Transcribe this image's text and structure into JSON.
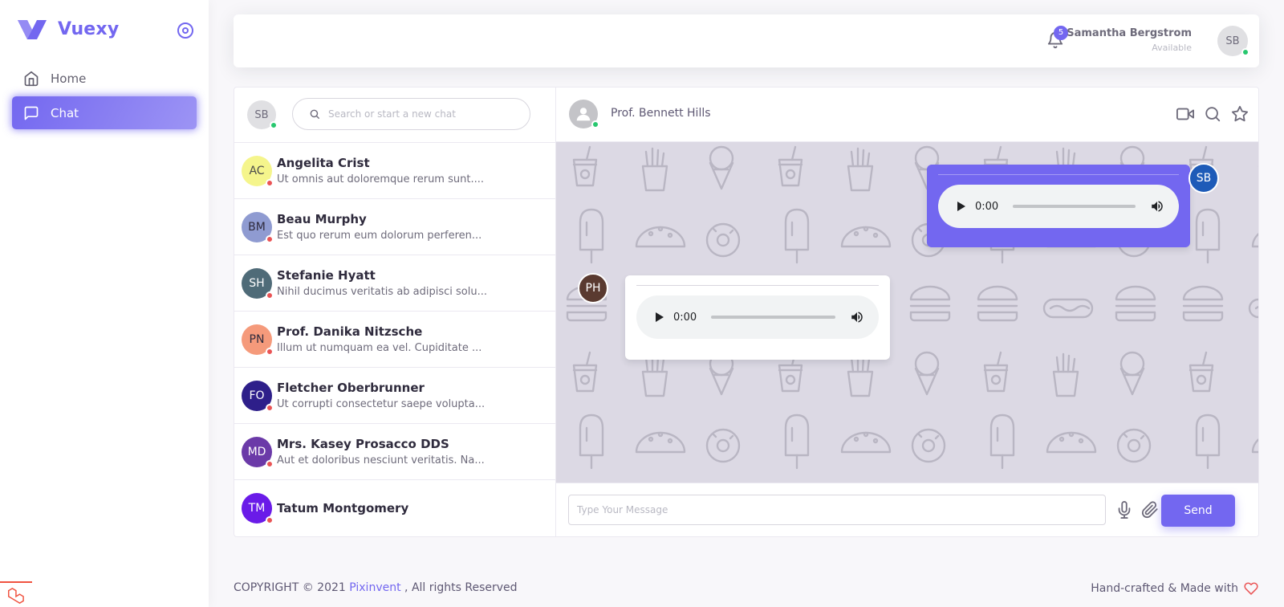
{
  "brand": {
    "name": "Vuexy"
  },
  "nav": {
    "items": [
      {
        "label": "Home",
        "icon": "home-icon"
      },
      {
        "label": "Chat",
        "icon": "message-square-icon",
        "active": true
      }
    ]
  },
  "header": {
    "notifications_count": "5",
    "user_name": "Samantha Bergstrom",
    "user_status": "Available",
    "user_initials": "SB"
  },
  "chat": {
    "my_initials": "SB",
    "search_placeholder": "Search or start a new chat",
    "contacts": [
      {
        "initials": "AC",
        "name": "Angelita Crist",
        "preview": "Ut omnis aut doloremque rerum sunt....",
        "color": "#f5f58c",
        "text_color": "#4b4b4b"
      },
      {
        "initials": "BM",
        "name": "Beau Murphy",
        "preview": "Est quo rerum eum dolorum perferen...",
        "color": "#8f9bd1",
        "text_color": "#2f2b3d"
      },
      {
        "initials": "SH",
        "name": "Stefanie Hyatt",
        "preview": "Nihil ducimus veritatis ab adipisci solu...",
        "color": "#4f6b78",
        "text_color": "#ffffff"
      },
      {
        "initials": "PN",
        "name": "Prof. Danika Nitzsche",
        "preview": "Illum ut numquam ea vel. Cupiditate ...",
        "color": "#f59a7b",
        "text_color": "#2f2b3d"
      },
      {
        "initials": "FO",
        "name": "Fletcher Oberbrunner",
        "preview": "Ut corrupti consectetur saepe volupta...",
        "color": "#2e1f8a",
        "text_color": "#ffffff"
      },
      {
        "initials": "MD",
        "name": "Mrs. Kasey Prosacco DDS",
        "preview": "Aut et doloribus nesciunt veritatis. Na...",
        "color": "#6b3aa8",
        "text_color": "#ffffff"
      },
      {
        "initials": "TM",
        "name": "Tatum Montgomery",
        "preview": "",
        "color": "#6a1be8",
        "text_color": "#ffffff"
      }
    ],
    "active_peer": {
      "name": "Prof. Bennett Hills"
    },
    "messages": [
      {
        "from": "me",
        "initials": "SB",
        "type": "audio",
        "time": "0:00",
        "avatar_color": "#1e5bb8"
      },
      {
        "from": "peer",
        "initials": "PH",
        "type": "audio",
        "time": "0:00",
        "avatar_color": "#5a3a30"
      }
    ],
    "composer_placeholder": "Type Your Message",
    "send_label": "Send"
  },
  "footer": {
    "copyright_prefix": "COPYRIGHT © 2021",
    "company": "Pixinvent",
    "copyright_suffix": ", All rights Reserved",
    "made_with": "Hand-crafted & Made with"
  },
  "colors": {
    "primary": "#7367f0",
    "online": "#28c76f",
    "offline": "#ea5455"
  }
}
